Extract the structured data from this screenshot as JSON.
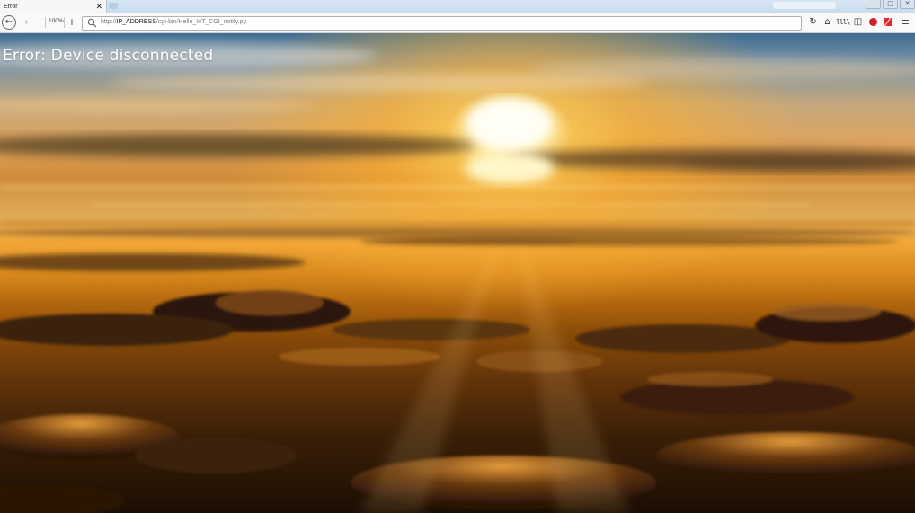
{
  "browser": {
    "tab": {
      "title": "Error",
      "close_glyph": "✕"
    },
    "window_controls": {
      "minimize": "–",
      "maximize": "□",
      "close": "✕"
    },
    "nav": {
      "back_glyph": "←",
      "forward_glyph": "→",
      "zoom_out_glyph": "−",
      "zoom_level": "100%",
      "zoom_in_glyph": "+",
      "url_prefix": "http://",
      "url_host": "IP_ADDRESS",
      "url_path": "/cgi-bin/Hello_IoT_CGI_notify.py"
    },
    "toolbar": {
      "reload_glyph": "↻",
      "home_glyph": "⌂",
      "library_glyph": "lll\\",
      "sidebar_glyph": "◫",
      "menu_glyph": "≡"
    }
  },
  "page": {
    "error_message": "Error: Device disconnected",
    "background": "sunset-above-clouds"
  }
}
